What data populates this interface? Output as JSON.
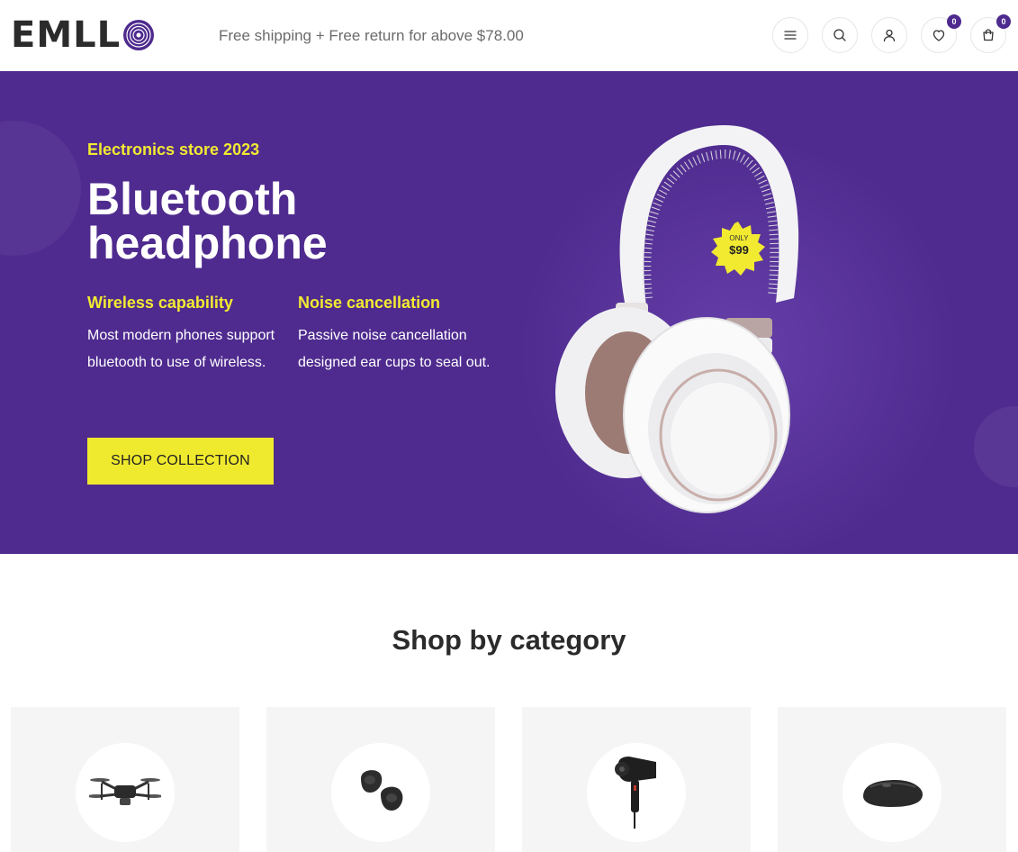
{
  "header": {
    "logo_text": "EMLL",
    "promo": "Free shipping + Free return for above $78.00",
    "icons": [
      {
        "name": "menu-icon",
        "badge": null
      },
      {
        "name": "search-icon",
        "badge": null
      },
      {
        "name": "user-icon",
        "badge": null
      },
      {
        "name": "heart-icon",
        "badge": "0"
      },
      {
        "name": "cart-icon",
        "badge": "0"
      }
    ]
  },
  "hero": {
    "eyebrow": "Electronics store 2023",
    "title": "Bluetooth headphone",
    "features": [
      {
        "title": "Wireless capability",
        "text": "Most modern phones support bluetooth to use of wireless."
      },
      {
        "title": "Noise cancellation",
        "text": "Passive noise cancellation designed ear cups to seal out."
      }
    ],
    "cta_label": "SHOP COLLECTION",
    "price_tag": {
      "top": "ONLY",
      "price": "$99"
    }
  },
  "categories": {
    "title": "Shop by category",
    "items": [
      {
        "icon": "drone-icon"
      },
      {
        "icon": "earbuds-icon"
      },
      {
        "icon": "hair-dryer-icon"
      },
      {
        "icon": "mouse-icon"
      }
    ]
  },
  "colors": {
    "brand_purple": "#4f2b8f",
    "accent_yellow": "#f2ea31",
    "badge": "#4e2a8e"
  }
}
